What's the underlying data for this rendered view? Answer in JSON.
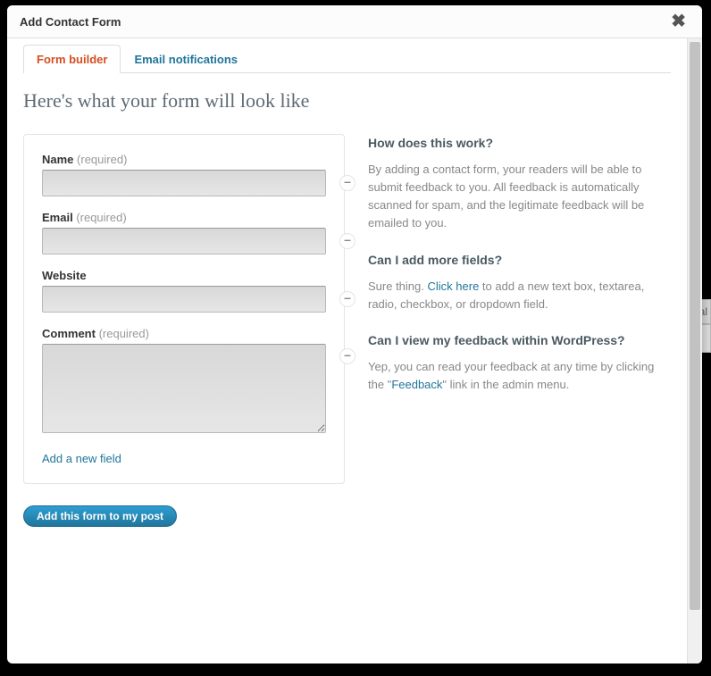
{
  "modal": {
    "title": "Add Contact Form",
    "close_glyph": "✖"
  },
  "tabs": {
    "builder": "Form builder",
    "emails": "Email notifications"
  },
  "preview_heading": "Here's what your form will look like",
  "fields": {
    "name": {
      "label": "Name",
      "req": "(required)"
    },
    "email": {
      "label": "Email",
      "req": "(required)"
    },
    "website": {
      "label": "Website",
      "req": ""
    },
    "comment": {
      "label": "Comment",
      "req": "(required)"
    }
  },
  "minus_glyph": "–",
  "add_field_link": "Add a new field",
  "submit_label": "Add this form to my post",
  "help": {
    "h1": "How does this work?",
    "p1": "By adding a contact form, your readers will be able to submit feedback to you. All feedback is automatically scanned for spam, and the legitimate feedback will be emailed to you.",
    "h2": "Can I add more fields?",
    "p2a": "Sure thing. ",
    "p2_link": "Click here",
    "p2b": " to add a new text box, textarea, radio, checkbox, or dropdown field.",
    "h3": "Can I view my feedback within WordPress?",
    "p3a": "Yep, you can read your feedback at any time by clicking the \"",
    "p3_link": "Feedback",
    "p3b": "\" link in the admin menu."
  },
  "bg": {
    "ual": "ual"
  }
}
